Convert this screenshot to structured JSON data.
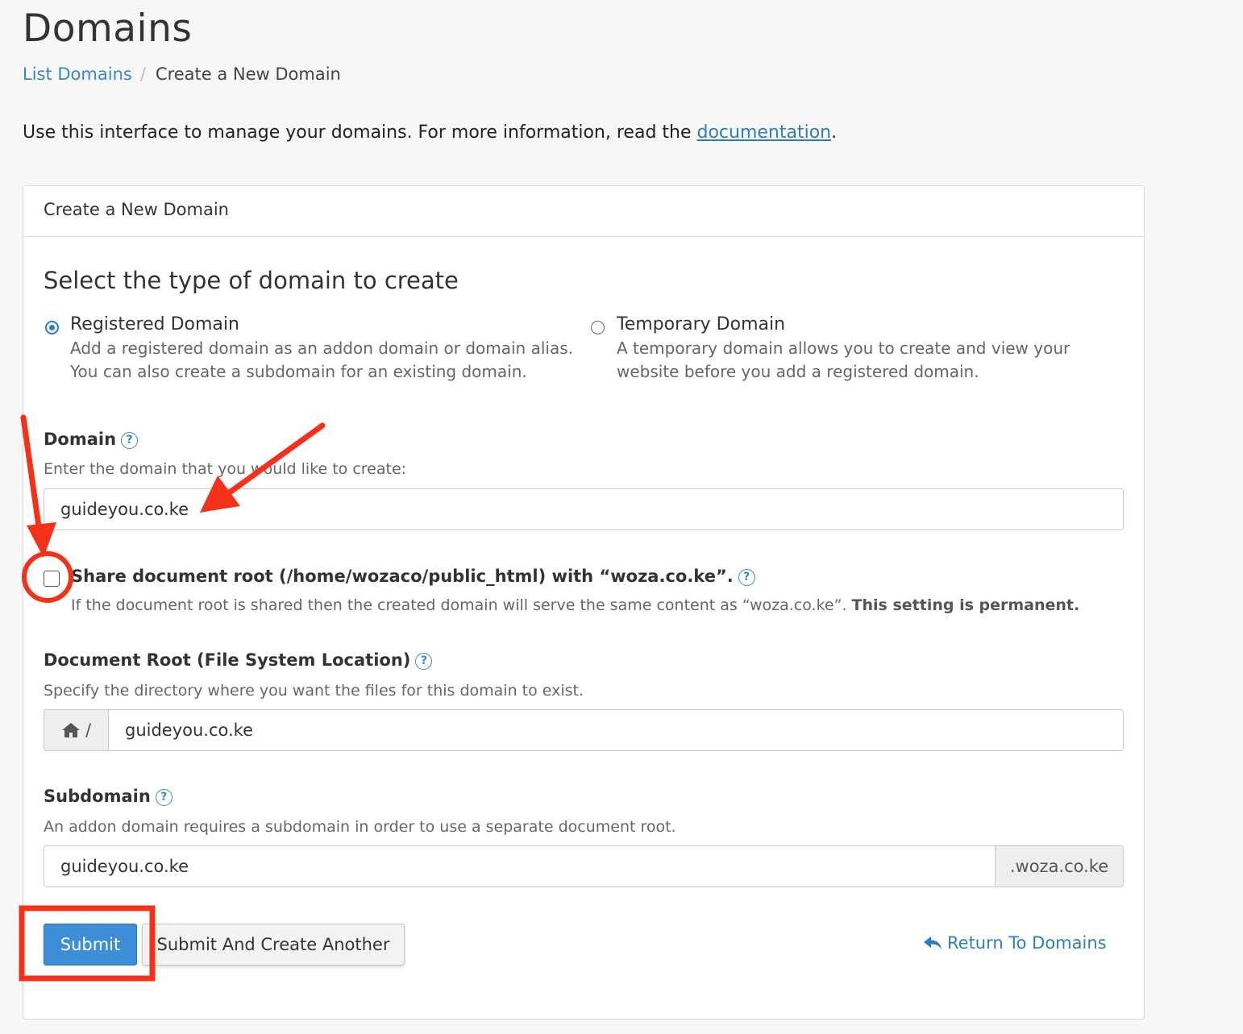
{
  "page": {
    "title": "Domains",
    "breadcrumb": {
      "link": "List Domains",
      "separator": "/",
      "current": "Create a New Domain"
    },
    "intro_text": "Use this interface to manage your domains. For more information, read the ",
    "intro_link": "documentation",
    "intro_end": "."
  },
  "panel": {
    "heading": "Create a New Domain",
    "section_title": "Select the type of domain to create",
    "options": [
      {
        "label": "Registered Domain",
        "checked": true,
        "desc_line1": "Add a registered domain as an addon domain or domain alias.",
        "desc_line2": "You can also create a subdomain for an existing domain."
      },
      {
        "label": "Temporary Domain",
        "checked": false,
        "desc_line1": "A temporary domain allows you to create and view your",
        "desc_line2": "website before you add a registered domain."
      }
    ]
  },
  "domain": {
    "label": "Domain",
    "hint": "Enter the domain that you would like to create:",
    "value": "guideyou.co.ke"
  },
  "share": {
    "label": "Share document root (/home/wozaco/public_html) with “woza.co.ke”.",
    "checked": false,
    "desc": "If the document root is shared then the created domain will serve the same content as “woza.co.ke”. ",
    "desc_strong": "This setting is permanent."
  },
  "docroot": {
    "label": "Document Root (File System Location)",
    "hint": "Specify the directory where you want the files for this domain to exist.",
    "prefix": "/",
    "value": "guideyou.co.ke"
  },
  "subdomain": {
    "label": "Subdomain",
    "hint": "An addon domain requires a subdomain in order to use a separate document root.",
    "value": "guideyou.co.ke",
    "suffix": ".woza.co.ke"
  },
  "buttons": {
    "submit": "Submit",
    "submit_another": "Submit And Create Another",
    "return": "Return To Domains"
  },
  "icons": {
    "help": "question-circle-icon",
    "home": "home-icon",
    "return": "reply-arrow-icon"
  },
  "colors": {
    "accent": "#3a87c8",
    "primary_button": "#3d8ed6",
    "annotation": "#f4311b"
  },
  "help_glyph": "?"
}
